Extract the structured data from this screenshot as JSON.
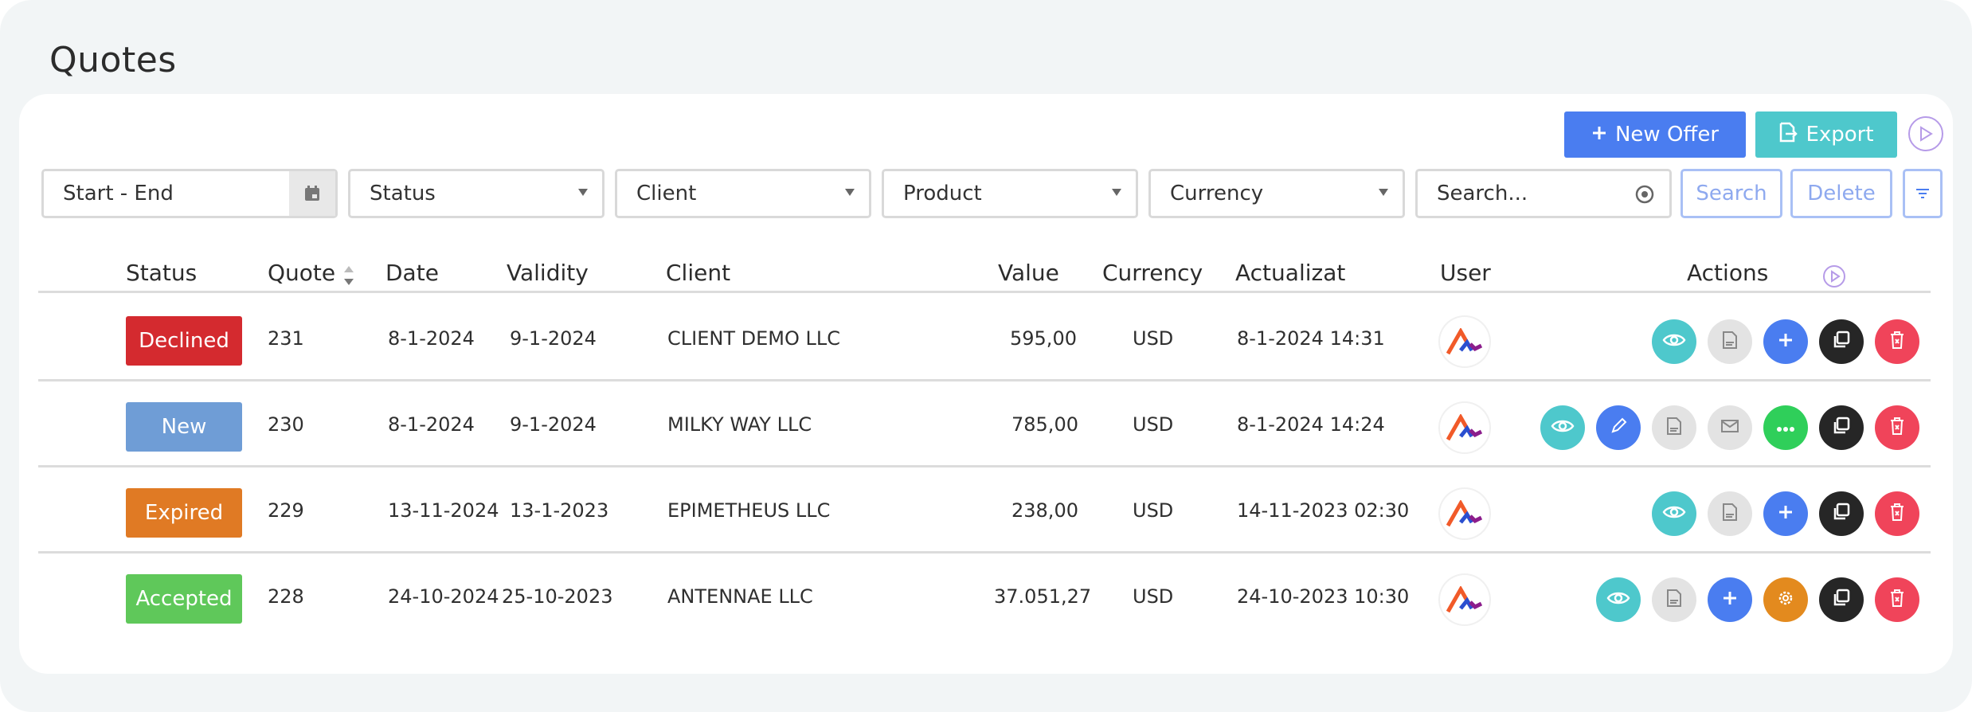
{
  "page": {
    "title": "Quotes"
  },
  "toolbar": {
    "new_offer": "New Offer",
    "export": "Export"
  },
  "filters": {
    "date_range": "Start - End",
    "status": "Status",
    "client": "Client",
    "product": "Product",
    "currency": "Currency",
    "search_placeholder": "Search...",
    "search_button": "Search",
    "delete_button": "Delete"
  },
  "table": {
    "headers": {
      "status": "Status",
      "quote": "Quote",
      "date": "Date",
      "validity": "Validity",
      "client": "Client",
      "value": "Value",
      "currency": "Currency",
      "updated": "Actualizat",
      "user": "User",
      "actions": "Actions"
    },
    "rows": [
      {
        "status": "Declined",
        "quote": "231",
        "date": "8-1-2024",
        "validity": "9-1-2024",
        "client": "CLIENT DEMO LLC",
        "value": "595,00",
        "currency": "USD",
        "updated": "8-1-2024 14:31"
      },
      {
        "status": "New",
        "quote": "230",
        "date": "8-1-2024",
        "validity": "9-1-2024",
        "client": "MILKY WAY LLC",
        "value": "785,00",
        "currency": "USD",
        "updated": "8-1-2024 14:24"
      },
      {
        "status": "Expired",
        "quote": "229",
        "date": "13-11-2024",
        "validity": "13-1-2023",
        "client": "EPIMETHEUS LLC",
        "value": "238,00",
        "currency": "USD",
        "updated": "14-11-2023 02:30"
      },
      {
        "status": "Accepted",
        "quote": "228",
        "date": "24-10-2024",
        "validity": "25-10-2023",
        "client": "ANTENNAE LLC",
        "value": "37.051,27",
        "currency": "USD",
        "updated": "24-10-2023 10:30"
      }
    ]
  },
  "colors": {
    "declined": "#d42a2f",
    "new": "#6f9dd6",
    "expired": "#e07a24",
    "accepted": "#5fc85a",
    "primary": "#4a7df0",
    "teal": "#4ec8cc"
  }
}
